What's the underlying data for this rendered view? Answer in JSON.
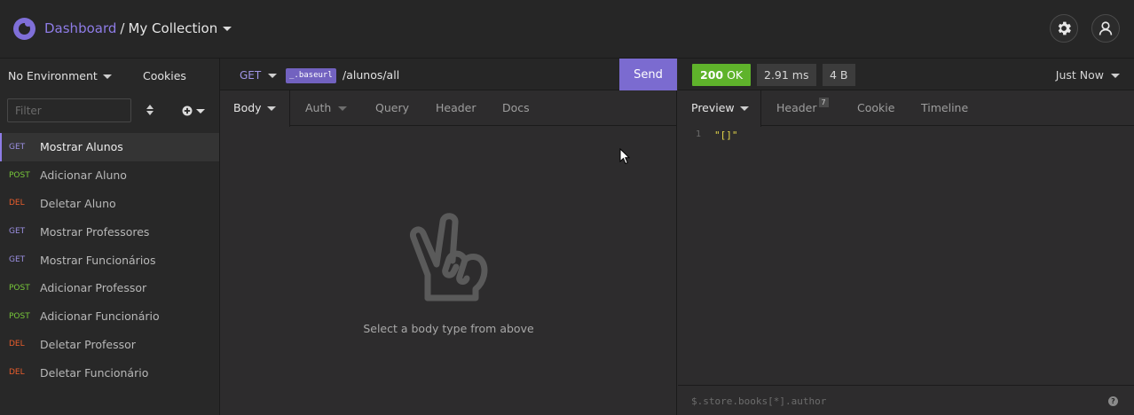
{
  "header": {
    "breadcrumb_root": "Dashboard",
    "breadcrumb_separator": "/",
    "collection_name": "My Collection",
    "accent_color": "#8e7ce6"
  },
  "sidebar": {
    "environment_label": "No Environment",
    "cookies_label": "Cookies",
    "filter_placeholder": "Filter",
    "requests": [
      {
        "method": "GET",
        "name": "Mostrar Alunos",
        "active": true
      },
      {
        "method": "POST",
        "name": "Adicionar Aluno"
      },
      {
        "method": "DEL",
        "name": "Deletar Aluno"
      },
      {
        "method": "GET",
        "name": "Mostrar Professores"
      },
      {
        "method": "GET",
        "name": "Mostrar Funcionários"
      },
      {
        "method": "POST",
        "name": "Adicionar Professor"
      },
      {
        "method": "POST",
        "name": "Adicionar Funcionário"
      },
      {
        "method": "DEL",
        "name": "Deletar Professor"
      },
      {
        "method": "DEL",
        "name": "Deletar Funcionário"
      }
    ],
    "method_colors": {
      "GET": "#9b8fe2",
      "POST": "#78c93a",
      "DEL": "#e85d2c"
    }
  },
  "request": {
    "method": "GET",
    "base_url_tag": "_.baseurl",
    "url_path": "/alunos/all",
    "send_label": "Send",
    "tabs": {
      "body": "Body",
      "auth": "Auth",
      "query": "Query",
      "header": "Header",
      "docs": "Docs"
    },
    "empty_message": "Select a body type from above",
    "empty_icon": "peace-hand-icon"
  },
  "response": {
    "status_code": "200",
    "status_text": "OK",
    "status_color": "#5fb32b",
    "time": "2.91 ms",
    "size": "4 B",
    "timestamp": "Just Now",
    "tabs": {
      "preview": "Preview",
      "header": "Header",
      "header_count": "7",
      "cookie": "Cookie",
      "timeline": "Timeline"
    },
    "body_lines": [
      {
        "number": "1",
        "text": "\"[]\""
      }
    ],
    "filter_placeholder": "$.store.books[*].author",
    "help_glyph": "?"
  }
}
